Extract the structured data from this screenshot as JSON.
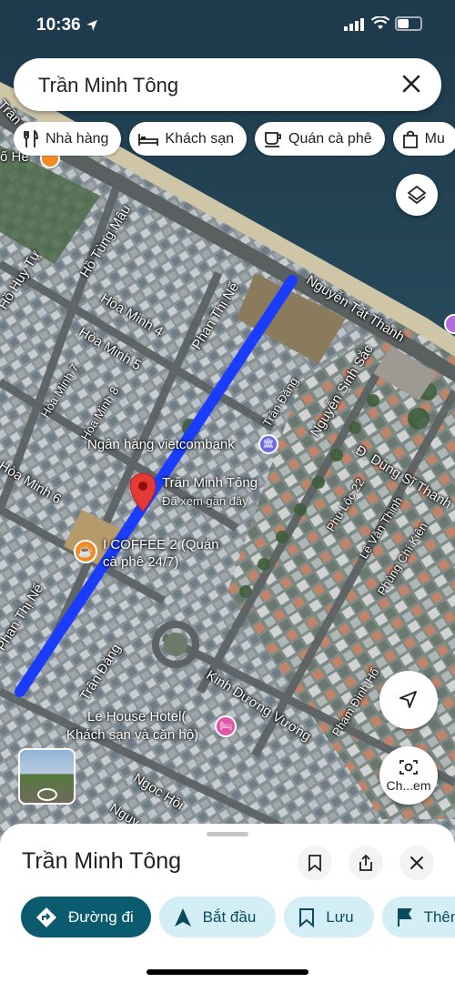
{
  "status_bar": {
    "time": "10:36",
    "signal": "••••",
    "wifi_icon": "wifi-icon",
    "battery_icon": "battery-icon"
  },
  "search": {
    "query": "Trần Minh Tông",
    "clear_icon": "close-icon"
  },
  "chips": [
    {
      "label": "Nhà hàng",
      "icon": "restaurant-icon"
    },
    {
      "label": "Khách sạn",
      "icon": "hotel-icon"
    },
    {
      "label": "Quán cà phê",
      "icon": "coffee-icon"
    },
    {
      "label": "Mu",
      "icon": "shopping-bag-icon"
    }
  ],
  "map": {
    "streets": {
      "tran_thanh": "Trần Thành",
      "ho_tung_mau": "Hồ Tùng Mậu",
      "ho_huy_tu": "Hồ Huy Tự",
      "nguyen_tat_thanh": "Nguyễn Tất Thành",
      "hoa_minh_4": "Hòa Minh 4",
      "hoa_minh_5": "Hòa Minh 5",
      "hoa_minh_7": "Hòa Minh 7",
      "hoa_minh_8": "Hòa Minh 8",
      "hoa_minh_6": "Hòa Minh 6",
      "phan_thi_ne_top": "Phan Thị Nể",
      "phan_thi_ne_left": "Phan Thị Nể",
      "tran_dang_top": "Trần Đăng",
      "tran_dang_bottom": "Trần Đăng",
      "nguyen_sinh_sac": "Nguyễn Sinh Sắc",
      "dung_si_thanh": "Đ. Dũng Sĩ Thanh",
      "phu_loc_22": "Phú Lộc 22",
      "le_van_thinh": "Lê Văn Thịnh",
      "phung_chi_kien": "Phùng Chí Kiên",
      "kinh_duong_vuong": "Kinh Dương Vương",
      "pham_dinh_ho": "Phạm Đình Hổ",
      "ngoc_hoi": "Ngọc Hồi",
      "nguy": "Nguy",
      "ho_he": "ố He"
    },
    "pois": {
      "vietcombank": "Ngân hàng vietcombank",
      "selected_name": "Trần Minh Tông",
      "selected_note": "Đã xem gần đây",
      "coffee_line1": "I COFFEE 2 (Quán",
      "coffee_line2": "cà phê 24/7)",
      "hotel_line1": "Le House Hotel(",
      "hotel_line2": "Khách sạn và căn hộ)"
    },
    "route_color": "#1a3cff"
  },
  "controls": {
    "layers_icon": "layers-icon",
    "locate_icon": "navigation-arrow-icon",
    "lens_label": "Ch...em",
    "street_view_icon": "street-view-icon"
  },
  "sheet": {
    "title": "Trần Minh Tông",
    "actions": [
      {
        "label": "Đường đi",
        "icon": "directions-icon"
      },
      {
        "label": "Bắt đầu",
        "icon": "navigation-icon"
      },
      {
        "label": "Lưu",
        "icon": "bookmark-icon"
      },
      {
        "label": "Thên",
        "icon": "flag-icon"
      }
    ]
  }
}
